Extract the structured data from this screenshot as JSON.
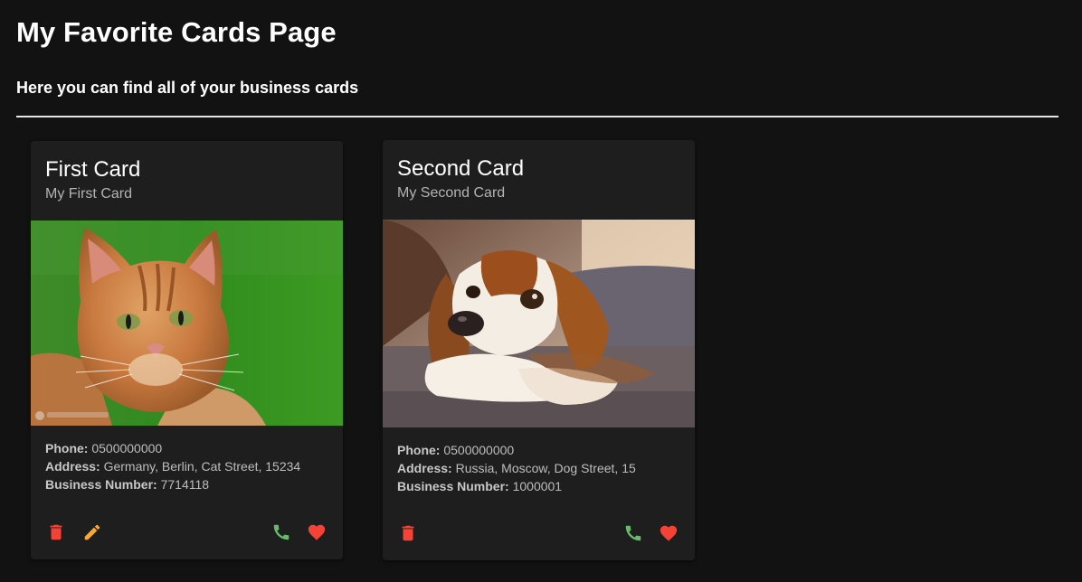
{
  "header": {
    "title": "My Favorite Cards Page",
    "subtitle": "Here you can find all of your business cards"
  },
  "colors": {
    "delete": "#f44336",
    "edit": "#ffa726",
    "call": "#66bb6a",
    "favorite": "#f44336"
  },
  "cards": [
    {
      "title": "First Card",
      "subtitle": "My First Card",
      "image": "orange-cat-photo",
      "phone_label": "Phone:",
      "phone": "0500000000",
      "address_label": "Address:",
      "address": "Germany, Berlin, Cat Street, 15234",
      "business_number_label": "Business Number:",
      "business_number": "7714118",
      "actions": [
        "delete-icon",
        "edit-icon",
        "phone-icon",
        "heart-icon"
      ]
    },
    {
      "title": "Second Card",
      "subtitle": "My Second Card",
      "image": "spaniel-dog-photo",
      "phone_label": "Phone:",
      "phone": "0500000000",
      "address_label": "Address:",
      "address": "Russia, Moscow, Dog Street, 15",
      "business_number_label": "Business Number:",
      "business_number": "1000001",
      "actions": [
        "delete-icon",
        "phone-icon",
        "heart-icon"
      ]
    }
  ]
}
